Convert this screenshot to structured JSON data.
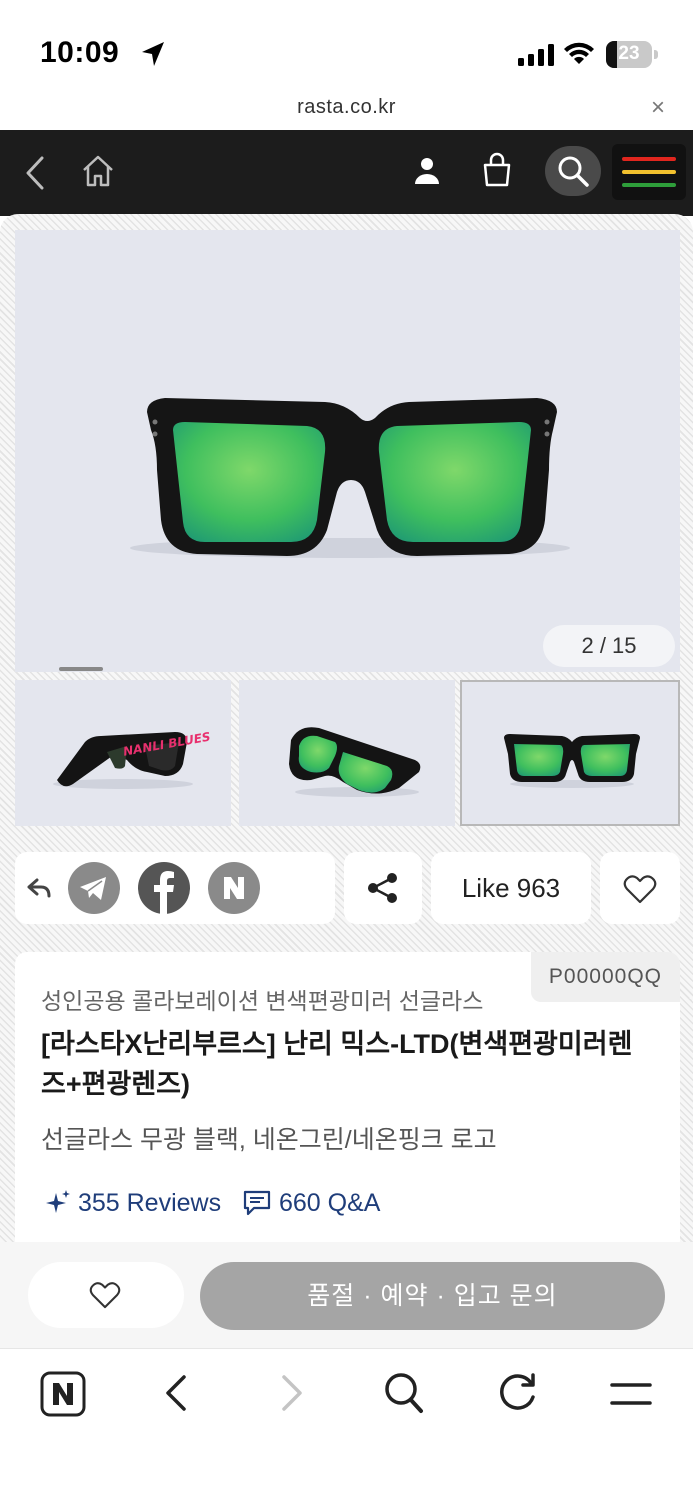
{
  "status_bar": {
    "time": "10:09",
    "battery_level": "23",
    "battery_fraction": 0.23
  },
  "browser": {
    "url": "rasta.co.kr",
    "close_label": "×"
  },
  "site_header": {
    "icons": [
      "back-icon",
      "home-icon",
      "user-icon",
      "shopping-bag-icon",
      "search-icon",
      "menu-icon"
    ],
    "menu_colors": [
      "#e0261e",
      "#f2c12e",
      "#2e9e3a"
    ]
  },
  "gallery": {
    "counter": "2 / 15",
    "current_index": 2,
    "total": 15,
    "lens_color": "#39c569",
    "frame_color": "#111111",
    "accent_text_color": "#e8306e"
  },
  "share": {
    "icons": [
      "reply-icon",
      "telegram-icon",
      "facebook-icon",
      "naver-icon",
      "share-icon"
    ],
    "like_label": "Like 963",
    "wish_icon": "heart-icon"
  },
  "product": {
    "code": "P00000QQ",
    "subtitle": "성인공용 콜라보레이션 변색편광미러 선글라스",
    "title": "[라스타X난리부르스] 난리 믹스-LTD(변색편광미러렌즈+편광렌즈)",
    "description": "선글라스 무광 블랙, 네온그린/네온핑크 로고",
    "reviews_label": "355 Reviews",
    "qa_label": "660 Q&A"
  },
  "purchase": {
    "soldout_label": "품절 · 예약 · 입고 문의"
  },
  "toolbar": {
    "icons": [
      "naver-n-icon",
      "back-arrow-icon",
      "forward-arrow-icon",
      "search-icon",
      "refresh-icon",
      "menu-icon"
    ]
  }
}
